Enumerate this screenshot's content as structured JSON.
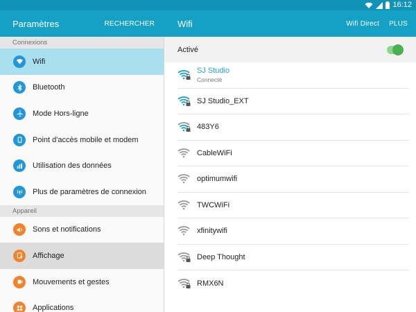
{
  "status_bar": {
    "time": "16:12"
  },
  "left_header": {
    "title": "Paramètres",
    "search_label": "RECHERCHER"
  },
  "right_header": {
    "title": "Wifi",
    "wifi_direct_label": "Wifi Direct",
    "more_label": "PLUS"
  },
  "sections": [
    {
      "title": "Connexions"
    },
    {
      "title": "Appareil"
    }
  ],
  "menu": [
    {
      "label": "Wifi",
      "icon": "wifi-icon",
      "color": "#2196d8"
    },
    {
      "label": "Bluetooth",
      "icon": "bluetooth-icon",
      "color": "#2196d8"
    },
    {
      "label": "Mode Hors-ligne",
      "icon": "airplane-icon",
      "color": "#2196d8"
    },
    {
      "label": "Point d'accès mobile et modem",
      "icon": "hotspot-icon",
      "color": "#2196d8"
    },
    {
      "label": "Utilisation des données",
      "icon": "data-usage-icon",
      "color": "#2196d8"
    },
    {
      "label": "Plus de paramètres de connexion",
      "icon": "more-connections-icon",
      "color": "#2196d8"
    },
    {
      "label": "Sons et notifications",
      "icon": "sound-icon",
      "color": "#f0842c"
    },
    {
      "label": "Affichage",
      "icon": "display-icon",
      "color": "#f0842c"
    },
    {
      "label": "Mouvements et gestes",
      "icon": "motion-icon",
      "color": "#f0842c"
    },
    {
      "label": "Applications",
      "icon": "apps-icon",
      "color": "#f0842c"
    }
  ],
  "wifi_toggle": {
    "label": "Activé",
    "state": "on"
  },
  "networks": [
    {
      "name": "SJ Studio",
      "status": "Connecté",
      "secured": true,
      "connected": true
    },
    {
      "name": "SJ Studio_EXT",
      "status": "",
      "secured": true,
      "connected": false
    },
    {
      "name": "483Y6",
      "status": "",
      "secured": true,
      "connected": false
    },
    {
      "name": "CableWiFi",
      "status": "",
      "secured": false,
      "connected": false
    },
    {
      "name": "optimumwifi",
      "status": "",
      "secured": false,
      "connected": false
    },
    {
      "name": "TWCWiFi",
      "status": "",
      "secured": false,
      "connected": false
    },
    {
      "name": "xfinitywifi",
      "status": "",
      "secured": false,
      "connected": false
    },
    {
      "name": "Deep Thought",
      "status": "",
      "secured": true,
      "connected": false
    },
    {
      "name": "RMX6N",
      "status": "",
      "secured": true,
      "connected": false
    }
  ],
  "colors": {
    "accent": "#15a0c6",
    "selected_bg": "#a9dfee",
    "connected_text": "#1aa3c9",
    "toggle_on": "#4cb050"
  }
}
